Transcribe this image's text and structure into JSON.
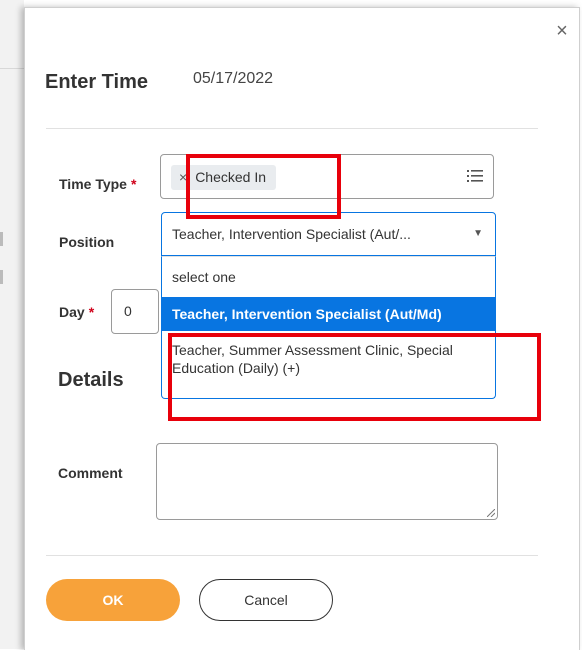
{
  "dialog": {
    "title": "Enter Time",
    "date": "05/17/2022",
    "close_glyph": "×"
  },
  "fields": {
    "time_type": {
      "label": "Time Type",
      "required_mark": "*",
      "selected_value": "Checked In",
      "remove_glyph": "×",
      "icon": "list-icon"
    },
    "position": {
      "label": "Position",
      "selected_value": "Teacher, Intervention Specialist (Aut/...",
      "arrow_glyph": "▼",
      "options": [
        "select one",
        "Teacher, Intervention Specialist (Aut/Md)",
        "Teacher, Summer Assessment Clinic, Special Education (Daily) (+)"
      ],
      "highlighted_option": "Teacher, Intervention Specialist (Aut/Md)"
    },
    "day": {
      "label": "Day",
      "required_mark": "*",
      "value": "0"
    },
    "comment": {
      "label": "Comment",
      "value": ""
    }
  },
  "section": {
    "details_heading": "Details"
  },
  "actions": {
    "ok_label": "OK",
    "cancel_label": "Cancel"
  },
  "colors": {
    "primary_blue": "#0875e1",
    "ok_orange": "#f7a23a",
    "required_red": "#d0021b",
    "annotation_red": "#e8000b"
  }
}
